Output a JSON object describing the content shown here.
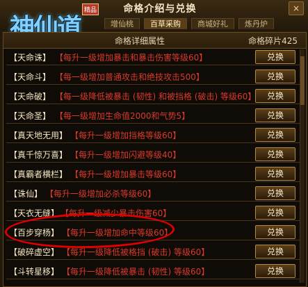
{
  "window": {
    "title": "命格介绍与兑换",
    "close_label": "×",
    "tabs": [
      "增仙桃",
      "百草采购",
      "商城好礼",
      "炼丹炉"
    ]
  },
  "logo": {
    "text": "神仙道",
    "badge": "精品"
  },
  "panel": {
    "header_left": "命格详细属性",
    "header_right": "命格碎片425"
  },
  "rows": [
    {
      "name": "【天命诛】",
      "desc": "【每升一级增加暴击和暴击伤害等级60】",
      "button": "兑换"
    },
    {
      "name": "【天命斗】",
      "desc": "【每一级增加普通攻击和绝技攻击500】",
      "button": "兑换"
    },
    {
      "name": "【天命破】",
      "desc": "【每一级降低被暴击 (韧性) 和被挡格 (破击) 等级60】",
      "button": "兑换"
    },
    {
      "name": "【天命圣】",
      "desc": "【每一级增加生命值2000和气势5】",
      "button": "兑换"
    },
    {
      "name": "【真天地无用】",
      "desc": "【每升一级增加挡格等级60】",
      "button": "兑换"
    },
    {
      "name": "【真千惊万喜】",
      "desc": "【每升一级增加闪避等级40】",
      "button": "兑换"
    },
    {
      "name": "【真霸者横栏】",
      "desc": "【每升一级增加暴击等级60】",
      "button": "兑换"
    },
    {
      "name": "【诛仙】",
      "desc": "【每升一级增加必杀等级60】",
      "button": "兑换"
    },
    {
      "name": "【天衣无缝】",
      "desc": "【每升一级减少暴击伤害60】",
      "button": "兑换"
    },
    {
      "name": "【百步穿杨】",
      "desc": "【每升一级增加命中等级60】",
      "button": "兑换"
    },
    {
      "name": "【破碎虚空】",
      "desc": "【每升一级降低被格挡 (破击) 等级60】",
      "button": "兑换"
    },
    {
      "name": "【斗转星移】",
      "desc": "【每升一级降低被暴击 (韧性) 等级60】",
      "button": "兑换"
    }
  ],
  "colors": {
    "desc_text": "#d93a2c",
    "highlight_circle": "#e00000"
  }
}
